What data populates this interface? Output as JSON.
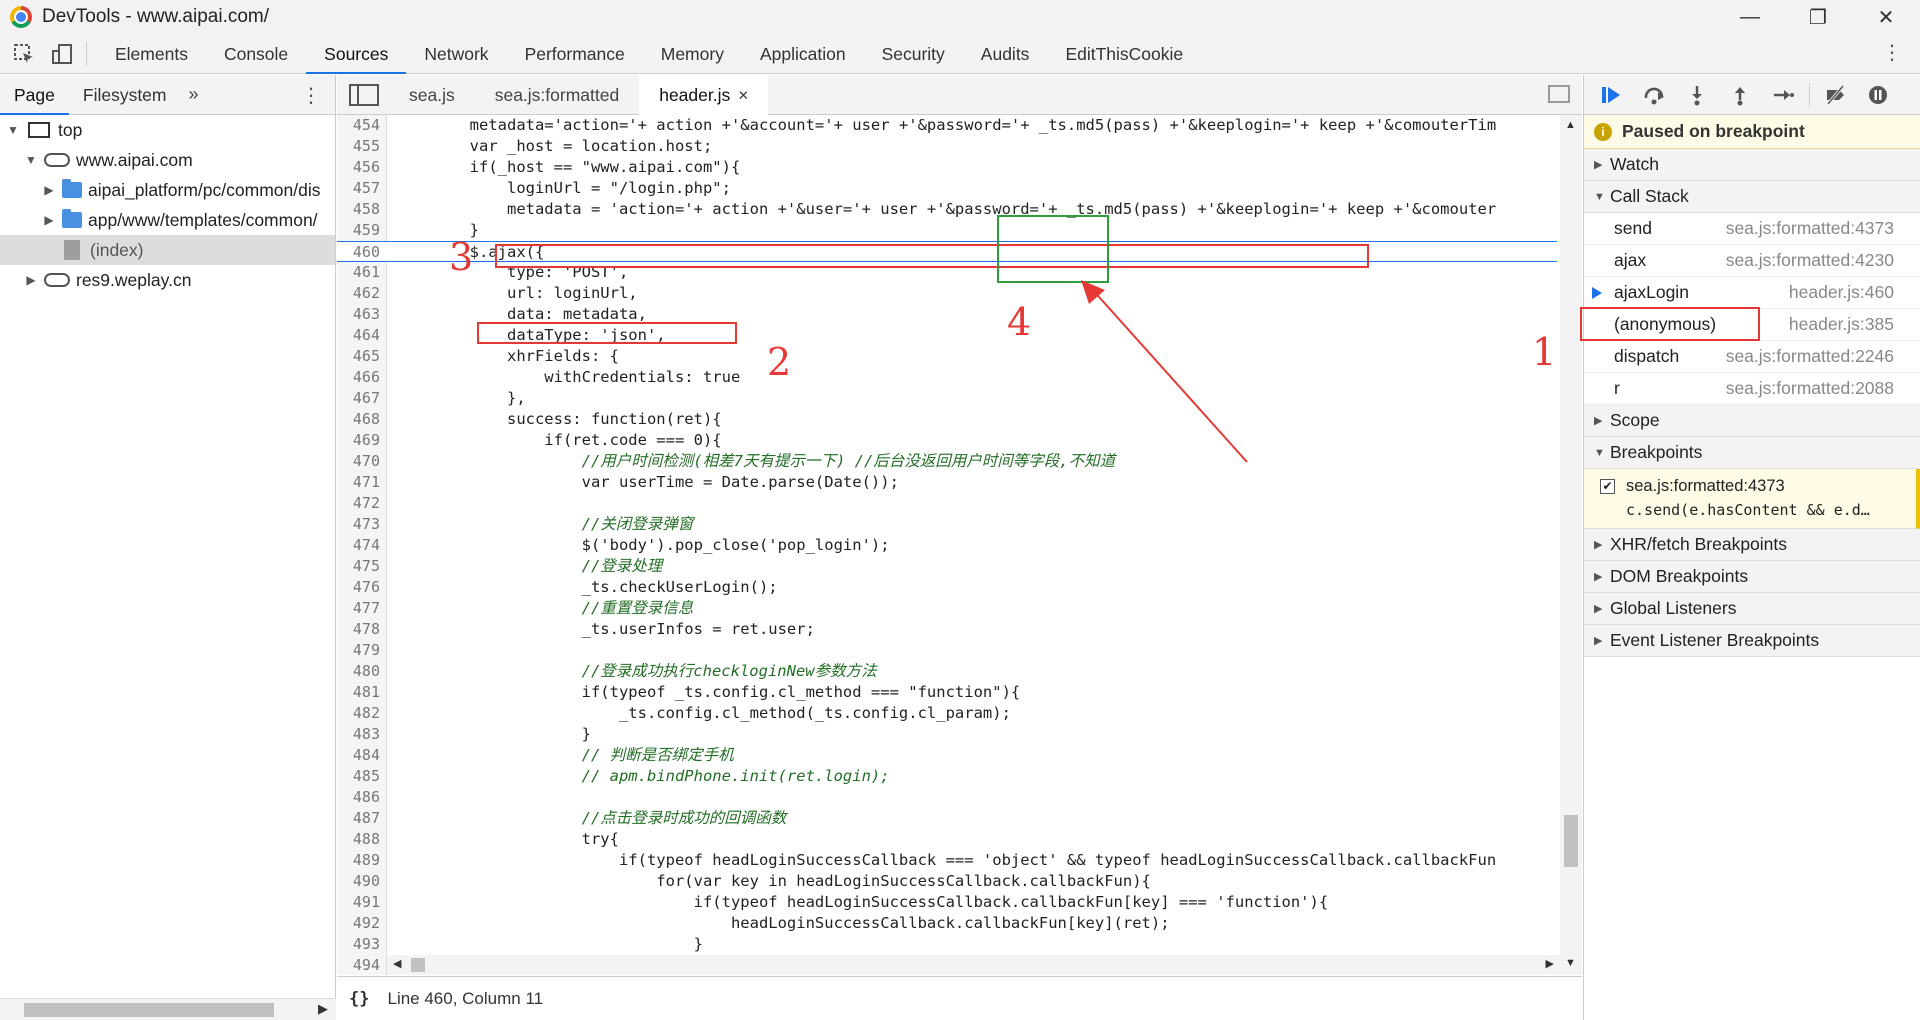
{
  "window": {
    "title": "DevTools - www.aipai.com/",
    "minimize": "—",
    "maximize": "❐",
    "close": "✕"
  },
  "main_tabs": [
    "Elements",
    "Console",
    "Sources",
    "Network",
    "Performance",
    "Memory",
    "Application",
    "Security",
    "Audits",
    "EditThisCookie"
  ],
  "main_tabs_active": "Sources",
  "more_menu": "⋮",
  "navigator": {
    "tabs": [
      "Page",
      "Filesystem"
    ],
    "more": "»",
    "kebab": "⋮",
    "tree": [
      {
        "label": "top"
      },
      {
        "label": "www.aipai.com"
      },
      {
        "label": "aipai_platform/pc/common/dis"
      },
      {
        "label": "app/www/templates/common/"
      },
      {
        "label": "(index)"
      },
      {
        "label": "res9.weplay.cn"
      }
    ]
  },
  "editor": {
    "tabs": [
      {
        "label": "sea.js"
      },
      {
        "label": "sea.js:formatted"
      },
      {
        "label": "header.js",
        "close": "×"
      }
    ],
    "lines": [
      {
        "n": "454",
        "code": "        metadata='action='+ action +'&account='+ user +'&password='+ _ts.md5(pass) +'&keeplogin='+ keep +'&comouterTim"
      },
      {
        "n": "455",
        "code": "        var _host = location.host;"
      },
      {
        "n": "456",
        "code": "        if(_host == \"www.aipai.com\"){"
      },
      {
        "n": "457",
        "code": "            loginUrl = \"/login.php\";"
      },
      {
        "n": "458",
        "code": "            metadata = 'action='+ action +'&user='+ user +'&password='+ _ts.md5(pass) +'&keeplogin='+ keep +'&comouter"
      },
      {
        "n": "459",
        "code": "        }"
      },
      {
        "n": "460",
        "code": "        $.ajax({"
      },
      {
        "n": "461",
        "code": "            type: 'POST',"
      },
      {
        "n": "462",
        "code": "            url: loginUrl,"
      },
      {
        "n": "463",
        "code": "            data: metadata,"
      },
      {
        "n": "464",
        "code": "            dataType: 'json',"
      },
      {
        "n": "465",
        "code": "            xhrFields: {"
      },
      {
        "n": "466",
        "code": "                withCredentials: true"
      },
      {
        "n": "467",
        "code": "            },"
      },
      {
        "n": "468",
        "code": "            success: function(ret){"
      },
      {
        "n": "469",
        "code": "                if(ret.code === 0){"
      },
      {
        "n": "470",
        "code": "                    //用户时间检测(相差7天有提示一下) //后台没返回用户时间等字段,不知道"
      },
      {
        "n": "471",
        "code": "                    var userTime = Date.parse(Date());"
      },
      {
        "n": "472",
        "code": ""
      },
      {
        "n": "473",
        "code": "                    //关闭登录弹窗"
      },
      {
        "n": "474",
        "code": "                    $('body').pop_close('pop_login');"
      },
      {
        "n": "475",
        "code": "                    //登录处理"
      },
      {
        "n": "476",
        "code": "                    _ts.checkUserLogin();"
      },
      {
        "n": "477",
        "code": "                    //重置登录信息"
      },
      {
        "n": "478",
        "code": "                    _ts.userInfos = ret.user;"
      },
      {
        "n": "479",
        "code": ""
      },
      {
        "n": "480",
        "code": "                    //登录成功执行checkloginNew参数方法"
      },
      {
        "n": "481",
        "code": "                    if(typeof _ts.config.cl_method === \"function\"){"
      },
      {
        "n": "482",
        "code": "                        _ts.config.cl_method(_ts.config.cl_param);"
      },
      {
        "n": "483",
        "code": "                    }"
      },
      {
        "n": "484",
        "code": "                    // 判断是否绑定手机"
      },
      {
        "n": "485",
        "code": "                    // apm.bindPhone.init(ret.login);"
      },
      {
        "n": "486",
        "code": ""
      },
      {
        "n": "487",
        "code": "                    //点击登录时成功的回调函数"
      },
      {
        "n": "488",
        "code": "                    try{"
      },
      {
        "n": "489",
        "code": "                        if(typeof headLoginSuccessCallback === 'object' && typeof headLoginSuccessCallback.callbackFun"
      },
      {
        "n": "490",
        "code": "                            for(var key in headLoginSuccessCallback.callbackFun){"
      },
      {
        "n": "491",
        "code": "                                if(typeof headLoginSuccessCallback.callbackFun[key] === 'function'){"
      },
      {
        "n": "492",
        "code": "                                    headLoginSuccessCallback.callbackFun[key](ret);"
      },
      {
        "n": "493",
        "code": "                                }"
      },
      {
        "n": "494",
        "code": ""
      }
    ],
    "current_line": "460",
    "status": "Line 460, Column 11",
    "braces": "{}"
  },
  "annotations": [
    "1",
    "2",
    "3",
    "4"
  ],
  "debugger": {
    "paused_text": "Paused on breakpoint",
    "sections": {
      "watch": "Watch",
      "call_stack": "Call Stack",
      "scope": "Scope",
      "breakpoints": "Breakpoints",
      "xhr": "XHR/fetch Breakpoints",
      "dom": "DOM Breakpoints",
      "global": "Global Listeners",
      "event": "Event Listener Breakpoints"
    },
    "call_stack": [
      {
        "name": "send",
        "loc": "sea.js:formatted:4373"
      },
      {
        "name": "ajax",
        "loc": "sea.js:formatted:4230"
      },
      {
        "name": "ajaxLogin",
        "loc": "header.js:460"
      },
      {
        "name": "(anonymous)",
        "loc": "header.js:385"
      },
      {
        "name": "dispatch",
        "loc": "sea.js:formatted:2246"
      },
      {
        "name": "r",
        "loc": "sea.js:formatted:2088"
      }
    ],
    "breakpoint": {
      "location": "sea.js:formatted:4373",
      "code": "c.send(e.hasContent && e.d…",
      "check": "✔"
    }
  },
  "colors": {
    "accent": "#1a73e8",
    "annotation_red": "#e53935",
    "annotation_green": "#2e9e3a",
    "paused_bg": "#fffbe6"
  }
}
